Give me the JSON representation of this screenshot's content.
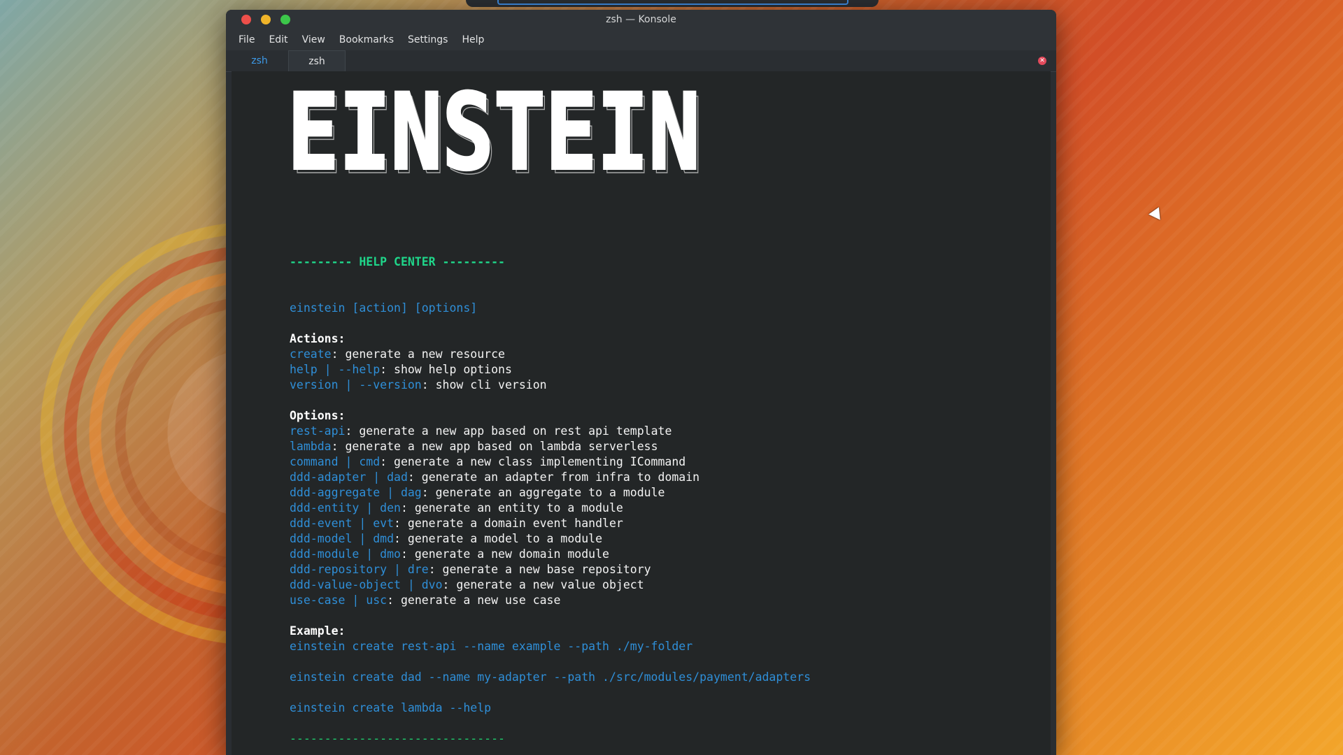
{
  "window": {
    "title": "zsh — Konsole"
  },
  "menu": [
    "File",
    "Edit",
    "View",
    "Bookmarks",
    "Settings",
    "Help"
  ],
  "tabs": [
    "zsh",
    "zsh"
  ],
  "terminal": {
    "logo_text": "EINSTEIN",
    "header": "--------- HELP CENTER ---------",
    "usage": "einstein [action] [options]",
    "actions_title": "Actions:",
    "actions": [
      {
        "cmd": "create",
        "desc": ": generate a new resource"
      },
      {
        "cmd": "help | --help",
        "desc": ": show help options"
      },
      {
        "cmd": "version | --version",
        "desc": ": show cli version"
      }
    ],
    "options_title": "Options:",
    "options": [
      {
        "cmd": "rest-api",
        "desc": ": generate a new app based on rest api template"
      },
      {
        "cmd": "lambda",
        "desc": ": generate a new app based on lambda serverless"
      },
      {
        "cmd": "command | cmd",
        "desc": ": generate a new class implementing ICommand"
      },
      {
        "cmd": "ddd-adapter | dad",
        "desc": ": generate an adapter from infra to domain"
      },
      {
        "cmd": "ddd-aggregate | dag",
        "desc": ": generate an aggregate to a module"
      },
      {
        "cmd": "ddd-entity | den",
        "desc": ": generate an entity to a module"
      },
      {
        "cmd": "ddd-event | evt",
        "desc": ": generate a domain event handler"
      },
      {
        "cmd": "ddd-model | dmd",
        "desc": ": generate a model to a module"
      },
      {
        "cmd": "ddd-module | dmo",
        "desc": ": generate a new domain module"
      },
      {
        "cmd": "ddd-repository | dre",
        "desc": ": generate a new base repository"
      },
      {
        "cmd": "ddd-value-object | dvo",
        "desc": ": generate a new value object"
      },
      {
        "cmd": "use-case | usc",
        "desc": ": generate a new use case"
      }
    ],
    "example_title": "Example:",
    "examples": [
      "einstein create rest-api --name example --path ./my-folder",
      "einstein create dad --name my-adapter --path ./src/modules/payment/adapters",
      "einstein create lambda --help"
    ],
    "footer": "-------------------------------"
  },
  "colors": {
    "cmd_blue": "#2f8fd8",
    "header_green": "#1fd68a",
    "terminal_bg": "#232627"
  }
}
